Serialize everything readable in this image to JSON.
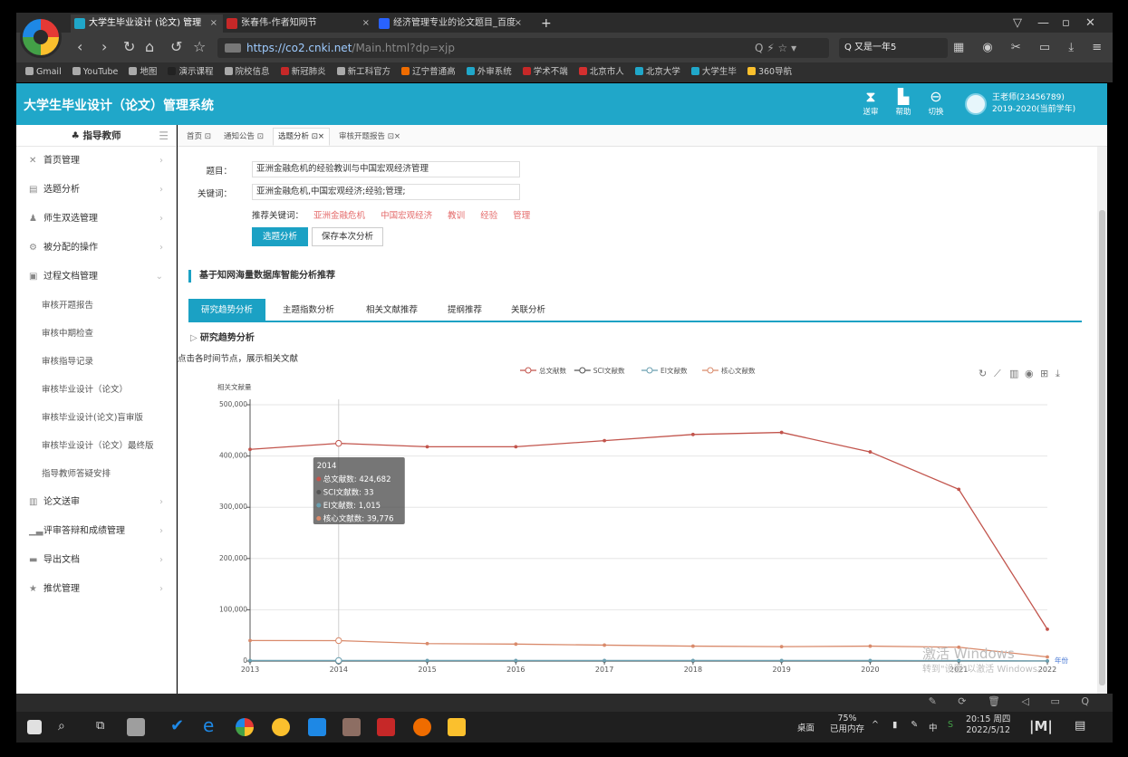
{
  "browser": {
    "tabs": [
      {
        "title": "大学生毕业设计 (论文) 管理",
        "close": "×"
      },
      {
        "title": "张春伟-作者知网节",
        "close": "×"
      },
      {
        "title": "经济管理专业的论文题目_百度",
        "close": "×"
      }
    ],
    "new_tab": "+",
    "url_main": "https://co2.cnki.net",
    "url_path": "/Main.html?dp=xjp",
    "search_text": "Q 又是一年5",
    "bookmarks": [
      "Gmail",
      "YouTube",
      "地图",
      "演示课程",
      "院校信息",
      "新冠肺炎",
      "新工科官方",
      "辽宁普通高",
      "外审系统",
      "学术不端",
      "北京市人",
      "北京大学",
      "大学生毕",
      "360导航"
    ]
  },
  "header": {
    "title": "大学生毕业设计（论文）管理系统",
    "buttons": [
      {
        "label": "送审"
      },
      {
        "label": "帮助"
      },
      {
        "label": "切换"
      }
    ],
    "user_name": "王老师(23456789)",
    "term": "2019-2020(当前学年)"
  },
  "sidebar": {
    "role": "指导教师",
    "items": [
      {
        "label": "首页管理",
        "icon": "tools-icon"
      },
      {
        "label": "选题分析",
        "icon": "chart-icon"
      },
      {
        "label": "师生双选管理",
        "icon": "users-icon"
      },
      {
        "label": "被分配的操作",
        "icon": "gear-icon"
      },
      {
        "label": "过程文档管理",
        "icon": "document-icon"
      }
    ],
    "sub_items": [
      "审核开题报告",
      "审核中期检查",
      "审核指导记录",
      "审核毕业设计（论文）",
      "审核毕业设计(论文)盲审版",
      "审核毕业设计（论文）最终版",
      "指导教师答疑安排"
    ],
    "items_after": [
      {
        "label": "论文送审",
        "icon": "folder-icon"
      },
      {
        "label": "评审答辩和成绩管理",
        "icon": "bar-icon"
      },
      {
        "label": "导出文档",
        "icon": "folder-icon"
      },
      {
        "label": "推优管理",
        "icon": "star-icon"
      }
    ]
  },
  "content_tabs": [
    {
      "label": "首页 ⊡"
    },
    {
      "label": "通知公告 ⊡"
    },
    {
      "label": "选题分析 ⊡×"
    },
    {
      "label": "审核开题报告 ⊡×"
    }
  ],
  "form": {
    "title_label": "题目：",
    "title_value": "亚洲金融危机的经验教训与中国宏观经济管理",
    "keywords_label": "关键词：",
    "keywords_value": "亚洲金融危机,中国宏观经济;经验;管理;",
    "recommend_label": "推荐关键词：",
    "recommend_keywords": [
      "亚洲金融危机",
      "中国宏观经济",
      "教训",
      "经验",
      "管理"
    ],
    "analyze_button": "选题分析",
    "save_button": "保存本次分析"
  },
  "section_title": "基于知网海量数据库智能分析推荐",
  "analysis_tabs": [
    "研究趋势分析",
    "主题指数分析",
    "相关文献推荐",
    "提纲推荐",
    "关联分析"
  ],
  "trend_heading": "研究趋势分析",
  "trend_hint": "点击各时间节点，展示相关文献",
  "chart_data": {
    "type": "line",
    "ylabel": "相关文献量",
    "xlabel": "年份",
    "x": [
      2013,
      2014,
      2015,
      2016,
      2017,
      2018,
      2019,
      2020,
      2021,
      2022
    ],
    "ylim": [
      0,
      500000
    ],
    "yticks": [
      "0",
      "100,000",
      "200,000",
      "300,000",
      "400,000",
      "500,000"
    ],
    "series": [
      {
        "name": "总文献数",
        "color": "#c2554d",
        "values": [
          413000,
          424682,
          418000,
          418000,
          430000,
          442000,
          446000,
          408000,
          335000,
          62000
        ]
      },
      {
        "name": "SCI文献数",
        "color": "#555555",
        "values": [
          30,
          33,
          30,
          30,
          30,
          30,
          30,
          30,
          20,
          5
        ]
      },
      {
        "name": "EI文献数",
        "color": "#6a9fb0",
        "values": [
          1000,
          1015,
          1000,
          1000,
          1000,
          1000,
          1000,
          1000,
          800,
          200
        ]
      },
      {
        "name": "核心文献数",
        "color": "#d98a6b",
        "values": [
          40000,
          39776,
          34000,
          33000,
          31000,
          29000,
          28000,
          29000,
          27000,
          8000
        ]
      }
    ],
    "legend_position": "top-center",
    "tooltip": {
      "year": "2014",
      "lines": [
        "总文献数: 424,682",
        "SCI文献数: 33",
        "EI文献数: 1,015",
        "核心文献数: 39,776"
      ]
    },
    "toolbox_icons": [
      "refresh-icon",
      "line-icon",
      "bar-icon",
      "stack-icon",
      "table-icon",
      "download-icon"
    ]
  },
  "watermark": {
    "line1": "激活 Windows",
    "line2": "转到\"设置\"以激活 Windows。"
  },
  "taskbar": {
    "desktop_label": "桌面",
    "memory_pct": "75%",
    "memory_label": "已用内存",
    "ime": "中",
    "time": "20:15 周四",
    "date": "2022/5/12"
  }
}
